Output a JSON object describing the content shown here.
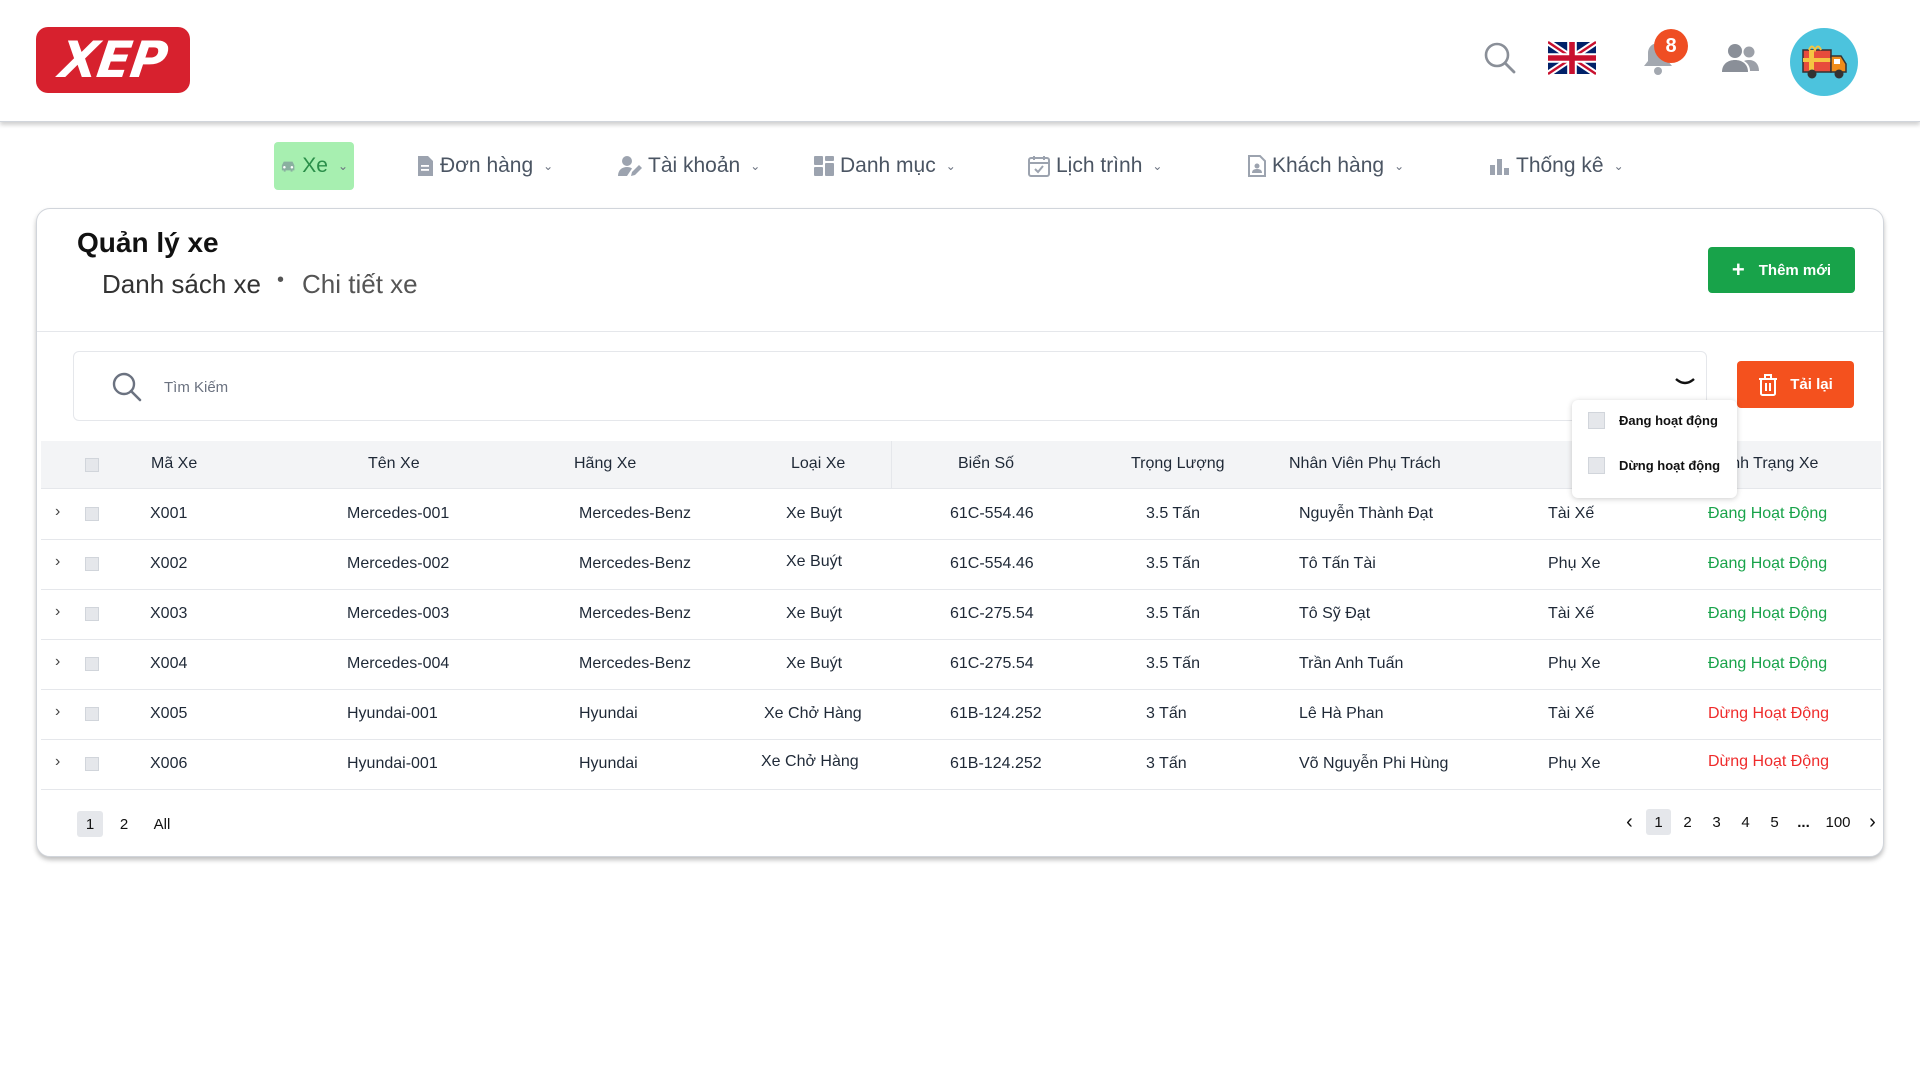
{
  "header": {
    "logo_text": "XEP",
    "notification_count": "8",
    "language_flag": "uk-flag-icon"
  },
  "nav": [
    {
      "label": "Xe",
      "icon": "car-icon",
      "active": true
    },
    {
      "label": "Đơn hàng",
      "icon": "document-icon"
    },
    {
      "label": "Tài khoản",
      "icon": "user-edit-icon"
    },
    {
      "label": "Danh mục",
      "icon": "grid-icon"
    },
    {
      "label": "Lịch trình",
      "icon": "calendar-icon"
    },
    {
      "label": "Khách hàng",
      "icon": "contact-file-icon"
    },
    {
      "label": "Thống kê",
      "icon": "bar-chart-icon"
    }
  ],
  "page": {
    "title": "Quản lý xe",
    "breadcrumb": [
      "Danh sách xe",
      "Chi tiết xe"
    ],
    "add_button": "Thêm mới",
    "reload_button": "Tải lại",
    "search_placeholder": "Tìm Kiếm"
  },
  "filter_options": [
    "Đang hoạt động",
    "Dừng hoạt động"
  ],
  "table": {
    "columns": [
      "Mã Xe",
      "Tên Xe",
      "Hãng Xe",
      "Loại Xe",
      "Biển Số",
      "Trọng Lượng",
      "Nhân Viên Phụ Trách",
      "Tình Trạng Xe"
    ],
    "rows": [
      {
        "id": "X001",
        "name": "Mercedes-001",
        "brand": "Mercedes-Benz",
        "type": "Xe Buýt",
        "plate": "61C-554.46",
        "weight": "3.5 Tấn",
        "staff": "Nguyễn Thành Đạt",
        "role": "Tài Xế",
        "status": "Đang Hoạt Động",
        "active": true
      },
      {
        "id": "X002",
        "name": "Mercedes-002",
        "brand": "Mercedes-Benz",
        "type": "Xe Buýt",
        "plate": "61C-554.46",
        "weight": "3.5 Tấn",
        "staff": "Tô Tấn Tài",
        "role": "Phụ Xe",
        "status": "Đang Hoạt Động",
        "active": true
      },
      {
        "id": "X003",
        "name": "Mercedes-003",
        "brand": "Mercedes-Benz",
        "type": "Xe Buýt",
        "plate": "61C-275.54",
        "weight": "3.5 Tấn",
        "staff": "Tô Sỹ Đạt",
        "role": "Tài Xế",
        "status": "Đang Hoạt Động",
        "active": true
      },
      {
        "id": "X004",
        "name": "Mercedes-004",
        "brand": "Mercedes-Benz",
        "type": "Xe Buýt",
        "plate": "61C-275.54",
        "weight": "3.5 Tấn",
        "staff": "Trần Anh Tuấn",
        "role": "Phụ Xe",
        "status": "Đang Hoạt Động",
        "active": true
      },
      {
        "id": "X005",
        "name": "Hyundai-001",
        "brand": "Hyundai",
        "type": "Xe Chở Hàng",
        "plate": "61B-124.252",
        "weight": "3 Tấn",
        "staff": "Lê Hà Phan",
        "role": "Tài Xế",
        "status": "Dừng Hoạt Động",
        "active": false
      },
      {
        "id": "X006",
        "name": "Hyundai-001",
        "brand": "Hyundai",
        "type": "Xe Chở Hàng",
        "plate": "61B-124.252",
        "weight": "3 Tấn",
        "staff": "Võ Nguyễn Phi Hùng",
        "role": "Phụ Xe",
        "status": "Dừng Hoạt Động",
        "active": false
      }
    ]
  },
  "page_size": {
    "options": [
      "1",
      "2",
      "All"
    ],
    "selected": "1"
  },
  "pagination": {
    "pages": [
      "1",
      "2",
      "3",
      "4",
      "5"
    ],
    "ellipsis": "...",
    "last": "100",
    "current": "1"
  },
  "colors": {
    "brand": "#d7212e",
    "nav_active": "#a7efb0",
    "add": "#18a34a",
    "reload": "#f4511e",
    "status_on": "#18a34a",
    "status_off": "#ef2b2b",
    "badge": "#ef4e23"
  }
}
